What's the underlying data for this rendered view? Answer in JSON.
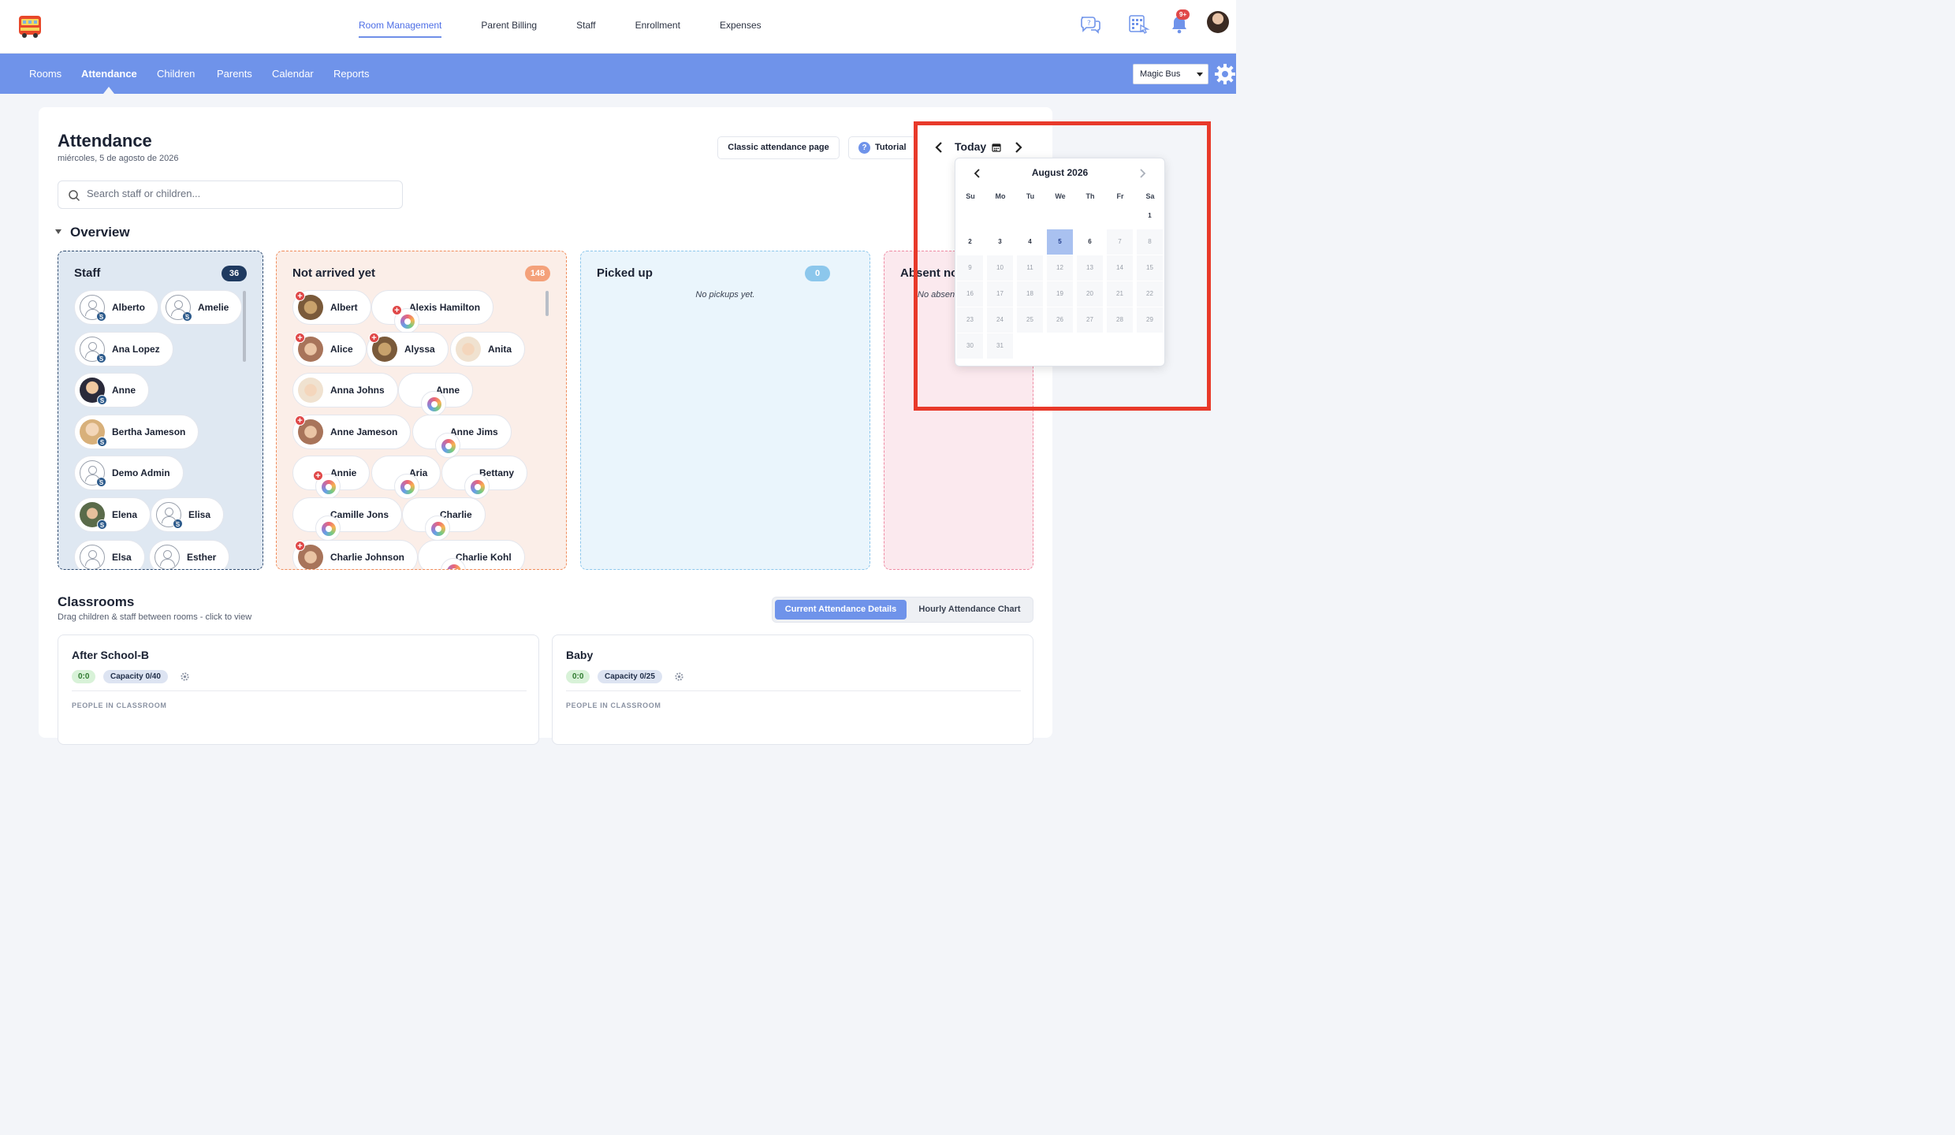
{
  "topnav": {
    "items": [
      "Room Management",
      "Parent Billing",
      "Staff",
      "Enrollment",
      "Expenses"
    ],
    "active": "Room Management",
    "notifications_badge": "9+"
  },
  "subnav": {
    "items": [
      "Rooms",
      "Attendance",
      "Children",
      "Parents",
      "Calendar",
      "Reports"
    ],
    "active": "Attendance",
    "centre_select": "Magic Bus"
  },
  "page": {
    "title": "Attendance",
    "date": "miércoles, 5 de agosto de 2026",
    "classic_button": "Classic attendance page",
    "tutorial_button": "Tutorial",
    "search_placeholder": "Search staff or children...",
    "overview_label": "Overview"
  },
  "panels": {
    "staff": {
      "title": "Staff",
      "count": "36",
      "people": [
        "Alberto",
        "Amelie",
        "Ana Lopez",
        "Anne",
        "Bertha Jameson",
        "Demo Admin",
        "Elena",
        "Elisa",
        "Elsa",
        "Esther"
      ]
    },
    "not_arrived": {
      "title": "Not arrived yet",
      "count": "148",
      "people": [
        "Albert",
        "Alexis Hamilton",
        "Alice",
        "Alyssa",
        "Anita",
        "Anna Johns",
        "Anne",
        "Anne Jameson",
        "Anne Jims",
        "Annie",
        "Aria",
        "Bettany",
        "Camille Jons",
        "Charlie",
        "Charlie Johnson",
        "Charlie Kohl"
      ]
    },
    "picked_up": {
      "title": "Picked up",
      "count": "0",
      "empty": "No pickups yet."
    },
    "absent": {
      "title": "Absent no",
      "empty": "No absen"
    }
  },
  "classrooms": {
    "title": "Classrooms",
    "subtitle": "Drag children & staff between rooms - click to view",
    "tabs": [
      "Current Attendance Details",
      "Hourly Attendance Chart"
    ],
    "active_tab": "Current Attendance Details",
    "rooms": [
      {
        "name": "After School-B",
        "ratio": "0:0",
        "capacity": "Capacity 0/40",
        "people_label": "PEOPLE IN CLASSROOM"
      },
      {
        "name": "Baby",
        "ratio": "0:0",
        "capacity": "Capacity 0/25",
        "people_label": "PEOPLE IN CLASSROOM"
      }
    ]
  },
  "date_nav": {
    "label": "Today"
  },
  "calendar": {
    "month": "August 2026",
    "weekdays": [
      "Su",
      "Mo",
      "Tu",
      "We",
      "Th",
      "Fr",
      "Sa"
    ],
    "weeks": [
      [
        "",
        "",
        "",
        "",
        "",
        "",
        "1"
      ],
      [
        "2",
        "3",
        "4",
        "5",
        "6",
        "7",
        "8"
      ],
      [
        "9",
        "10",
        "11",
        "12",
        "13",
        "14",
        "15"
      ],
      [
        "16",
        "17",
        "18",
        "19",
        "20",
        "21",
        "22"
      ],
      [
        "23",
        "24",
        "25",
        "26",
        "27",
        "28",
        "29"
      ],
      [
        "30",
        "31",
        "",
        "",
        "",
        "",
        ""
      ]
    ],
    "selected": "5",
    "enabled_days": [
      "1",
      "2",
      "3",
      "4",
      "5",
      "6"
    ]
  },
  "colors": {
    "accent": "#6f93ea",
    "highlight_box": "#e8392a",
    "staff_count": "#1f3a60",
    "not_arrived_count": "#f4a17a",
    "picked_up_count": "#8cc7ec"
  }
}
